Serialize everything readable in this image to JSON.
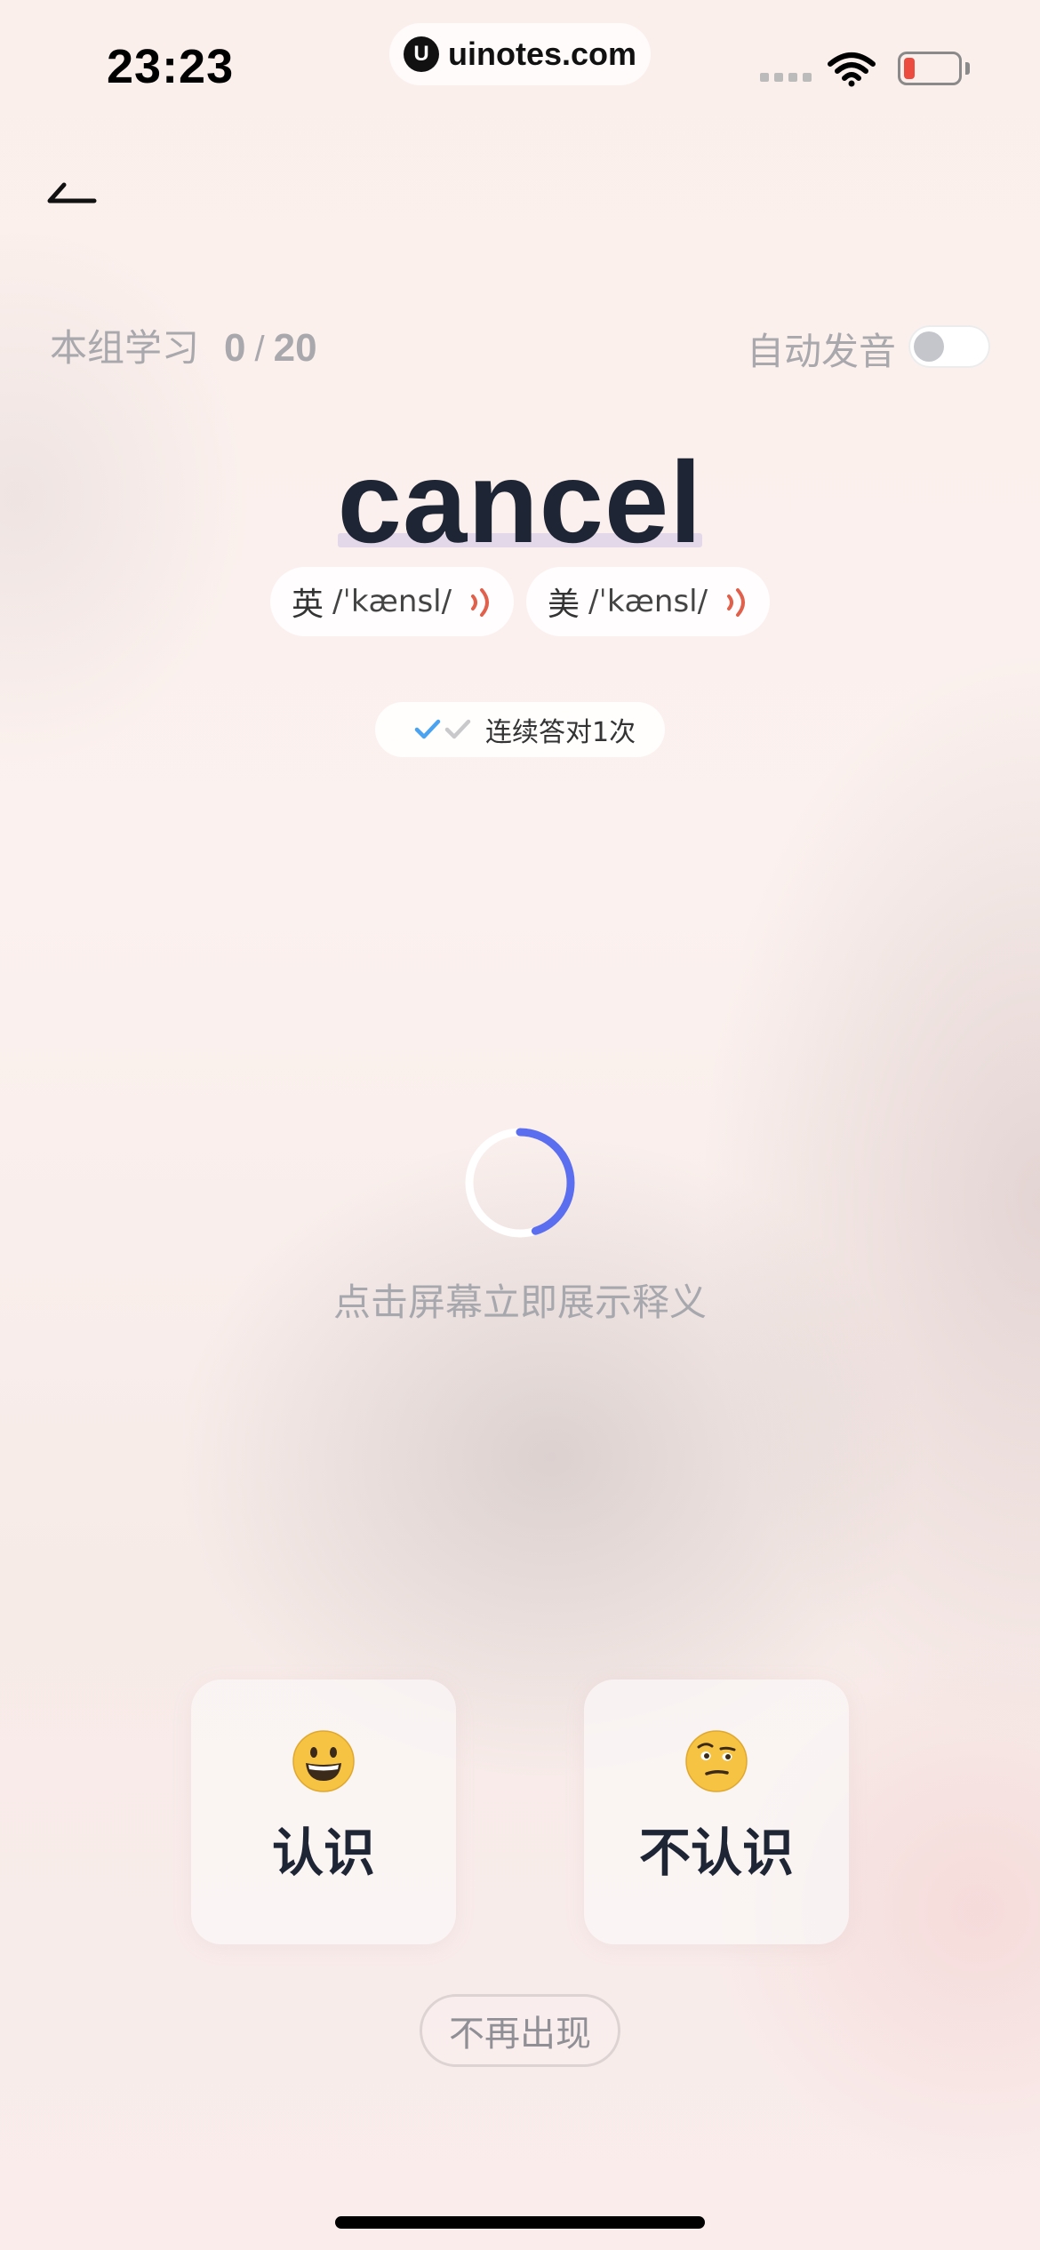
{
  "status_bar": {
    "time": "23:23",
    "site": "uinotes.com",
    "site_logo_letter": "U",
    "battery_color": "#ec4b3f"
  },
  "header": {
    "back_icon": "back-arrow-icon"
  },
  "progress": {
    "label": "本组学习",
    "current": "0",
    "separator": "/",
    "total": "20"
  },
  "auto_pronounce": {
    "label": "自动发音",
    "enabled": false
  },
  "word": {
    "text": "cancel",
    "phonetics": [
      {
        "region": "英",
        "ipa": "/ˈkænsl/",
        "icon": "speaker-icon"
      },
      {
        "region": "美",
        "ipa": "/ˈkænsl/",
        "icon": "speaker-icon"
      }
    ]
  },
  "streak": {
    "text": "连续答对1次",
    "checks_done": 1,
    "checks_total": 2,
    "done_color": "#4aa3f0",
    "pending_color": "#c9c9cc"
  },
  "loader": {
    "accent": "#5b6ef0",
    "progress": 0.45
  },
  "hint": "点击屏幕立即展示释义",
  "answers": {
    "know": {
      "label": "认识",
      "icon": "grinning-face-icon"
    },
    "unknown": {
      "label": "不认识",
      "icon": "raised-eyebrow-face-icon"
    }
  },
  "never_show": "不再出现"
}
